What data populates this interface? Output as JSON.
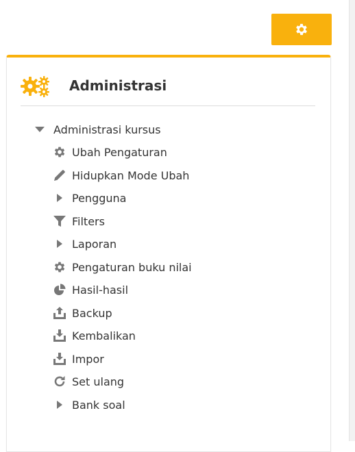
{
  "settings_button": {
    "icon": "gear-icon",
    "color": "#f9b10d"
  },
  "block": {
    "title": "Administrasi",
    "icon": "gears-icon",
    "accent": "#f9b10d"
  },
  "tree": {
    "root_label": "Administrasi kursus",
    "items": [
      {
        "label": "Ubah Pengaturan",
        "icon": "gear-icon"
      },
      {
        "label": "Hidupkan Mode Ubah",
        "icon": "pencil-icon"
      },
      {
        "label": "Pengguna",
        "icon": "caret-right-icon"
      },
      {
        "label": "Filters",
        "icon": "filter-icon"
      },
      {
        "label": "Laporan",
        "icon": "caret-right-icon"
      },
      {
        "label": "Pengaturan buku nilai",
        "icon": "gear-icon"
      },
      {
        "label": "Hasil-hasil",
        "icon": "pie-chart-icon"
      },
      {
        "label": "Backup",
        "icon": "upload-icon"
      },
      {
        "label": "Kembalikan",
        "icon": "download-icon"
      },
      {
        "label": "Impor",
        "icon": "download-icon"
      },
      {
        "label": "Set ulang",
        "icon": "refresh-icon"
      },
      {
        "label": "Bank soal",
        "icon": "caret-right-icon"
      }
    ]
  }
}
